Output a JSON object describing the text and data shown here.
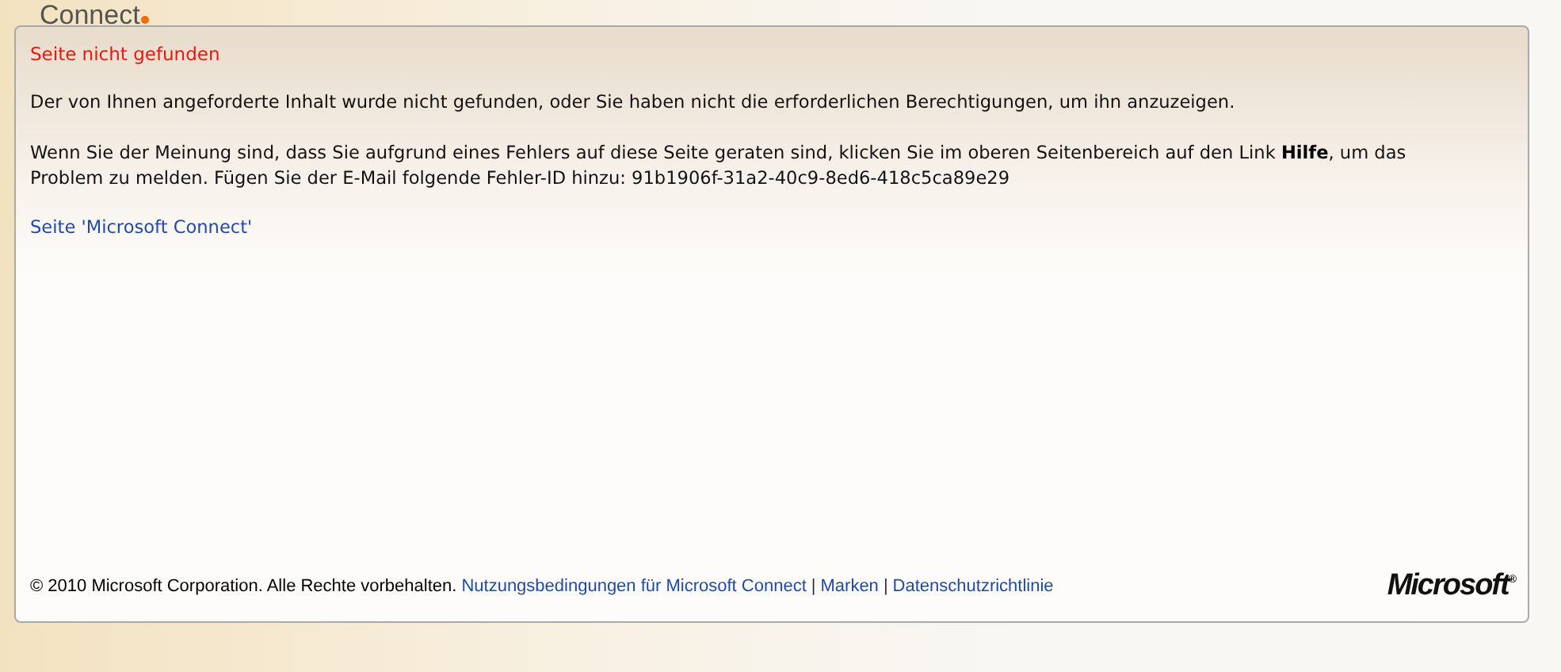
{
  "header": {
    "logo": "Connect"
  },
  "panel": {
    "title": "Seite nicht gefunden",
    "paragraphs": [
      "Der von Ihnen angeforderte Inhalt wurde nicht gefunden, oder Sie haben nicht die erforderlichen Berechtigungen, um ihn anzuzeigen.",
      "Wenn Sie der Meinung sind, dass Sie aufgrund eines Fehlers auf diese Seite geraten sind, klicken Sie im oberen Seitenbereich auf den Link **Hilfe**, um das Problem zu melden. Fügen Sie der E-Mail folgende Fehler-ID hinzu: 91b1906f-31a2-40c9-8ed6-418c5ca89e29"
    ],
    "home_link": "Seite 'Microsoft Connect'"
  },
  "footer": {
    "copyright": "© 2010 Microsoft Corporation. Alle Rechte vorbehalten.",
    "links": [
      "Nutzungsbedingungen für Microsoft Connect",
      "Marken",
      "Datenschutzrichtlinie"
    ],
    "separator": "|",
    "logo": "Microsoft$^{®}$"
  }
}
